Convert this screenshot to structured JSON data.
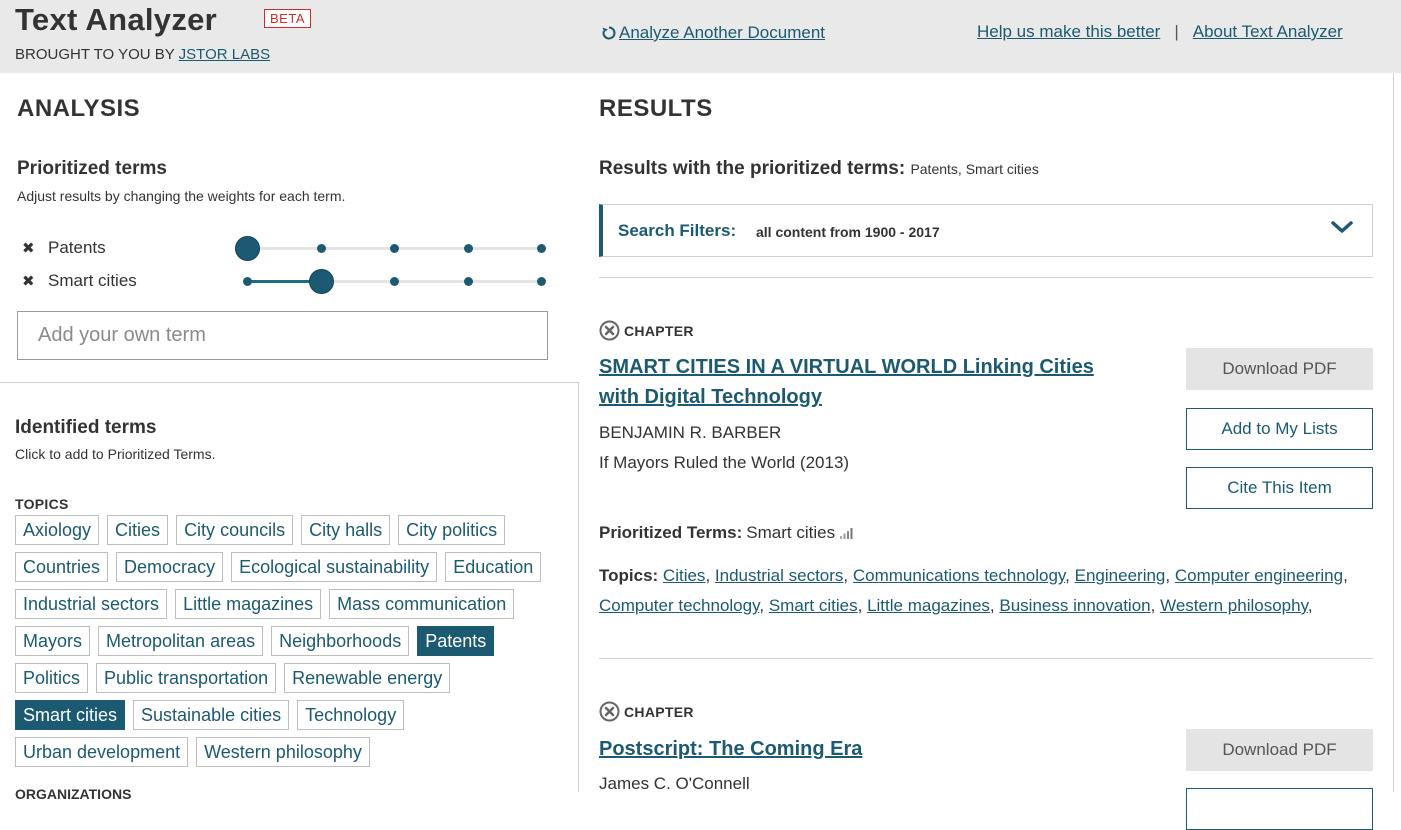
{
  "header": {
    "app_title": "Text Analyzer",
    "beta_badge": "BETA",
    "brought_prefix": "BROUGHT TO YOU BY",
    "brought_link": "JSTOR LABS",
    "analyze_another": "Analyze Another Document",
    "help_link": "Help us make this better",
    "separator": "|",
    "about_link": "About Text Analyzer"
  },
  "analysis": {
    "title": "ANALYSIS",
    "prioritized_title": "Prioritized terms",
    "prioritized_desc": "Adjust results by changing the weights for each term.",
    "terms": [
      {
        "remove": "✖",
        "name": "Patents",
        "weight_level": 1,
        "weight_max": 5
      },
      {
        "remove": "✖",
        "name": "Smart cities",
        "weight_level": 2,
        "weight_max": 5
      }
    ],
    "add_term_placeholder": "Add your own term",
    "identified_title": "Identified terms",
    "identified_desc": "Click to add to Prioritized Terms.",
    "topics_label": "TOPICS",
    "topics": [
      {
        "label": "Axiology",
        "selected": false
      },
      {
        "label": "Cities",
        "selected": false
      },
      {
        "label": "City councils",
        "selected": false
      },
      {
        "label": "City halls",
        "selected": false
      },
      {
        "label": "City politics",
        "selected": false
      },
      {
        "label": "Countries",
        "selected": false
      },
      {
        "label": "Democracy",
        "selected": false
      },
      {
        "label": "Ecological sustainability",
        "selected": false
      },
      {
        "label": "Education",
        "selected": false
      },
      {
        "label": "Industrial sectors",
        "selected": false
      },
      {
        "label": "Little magazines",
        "selected": false
      },
      {
        "label": "Mass communication",
        "selected": false
      },
      {
        "label": "Mayors",
        "selected": false
      },
      {
        "label": "Metropolitan areas",
        "selected": false
      },
      {
        "label": "Neighborhoods",
        "selected": false
      },
      {
        "label": "Patents",
        "selected": true
      },
      {
        "label": "Politics",
        "selected": false
      },
      {
        "label": "Public transportation",
        "selected": false
      },
      {
        "label": "Renewable energy",
        "selected": false
      },
      {
        "label": "Smart cities",
        "selected": true
      },
      {
        "label": "Sustainable cities",
        "selected": false
      },
      {
        "label": "Technology",
        "selected": false
      },
      {
        "label": "Urban development",
        "selected": false
      },
      {
        "label": "Western philosophy",
        "selected": false
      }
    ],
    "organizations_label": "ORGANIZATIONS"
  },
  "results": {
    "title": "RESULTS",
    "with_terms_label": "Results with the prioritized terms:",
    "with_terms_value": "Patents, Smart cities",
    "filters_label": "Search Filters:",
    "filters_value": "all content from 1900 - 2017",
    "items": [
      {
        "type": "CHAPTER",
        "title_line1": "SMART CITIES IN A VIRTUAL WORLD Linking Cities",
        "title_line2": "with Digital Technology",
        "author": "BENJAMIN R. BARBER",
        "source": "If Mayors Ruled the World (2013)",
        "prio_label": "Prioritized Terms:",
        "prio_value": "Smart cities",
        "topics_label": "Topics:",
        "topics": [
          "Cities",
          "Industrial sectors",
          "Communications technology",
          "Engineering",
          "Computer engineering",
          "Computer technology",
          "Smart cities",
          "Little magazines",
          "Business innovation",
          "Western philosophy"
        ],
        "download": "Download PDF",
        "add_list": "Add to My Lists",
        "cite": "Cite This Item"
      },
      {
        "type": "CHAPTER",
        "title_line1": "Postscript: The Coming Era",
        "author": "James C. O'Connell",
        "download": "Download PDF"
      }
    ]
  }
}
